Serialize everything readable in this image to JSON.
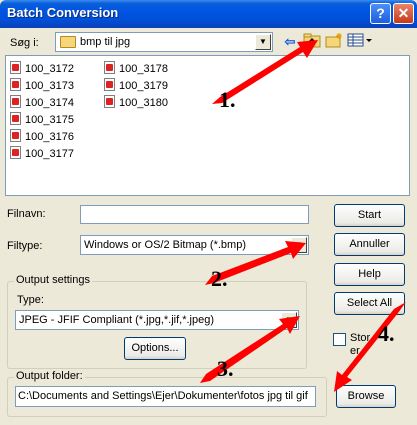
{
  "window": {
    "title": "Batch Conversion",
    "help_glyph": "?",
    "close_glyph": "✕"
  },
  "lookin": {
    "label": "Søg i:",
    "folder": "bmp til jpg"
  },
  "files": [
    "100_3172",
    "100_3173",
    "100_3174",
    "100_3175",
    "100_3176",
    "100_3177",
    "100_3178",
    "100_3179",
    "100_3180"
  ],
  "filename": {
    "label": "Filnavn:",
    "value": ""
  },
  "filetype": {
    "label": "Filtype:",
    "value": "Windows or OS/2 Bitmap (*.bmp)"
  },
  "output_settings": {
    "title": "Output settings",
    "type_label": "Type:",
    "type_value": "JPEG - JFIF Compliant (*.jpg,*.jif,*.jpeg)",
    "options_label": "Options..."
  },
  "output_folder": {
    "title": "Output folder:",
    "path": "C:\\Documents and Settings\\Ejer\\Dokumenter\\fotos jpg til gif",
    "browse_label": "Browse"
  },
  "buttons": {
    "start": "Start",
    "cancel": "Annuller",
    "help": "Help",
    "select_all": "Select All"
  },
  "store_checkbox": {
    "label_line1": "Stor",
    "label_line2": "er",
    "checked": false
  },
  "annotations": {
    "n1": "1.",
    "n2": "2.",
    "n3": "3.",
    "n4": "4.",
    "arrow_color": "#ff0000"
  },
  "icons": {
    "back": "back-arrow-icon",
    "up": "up-folder-icon",
    "new_folder": "new-folder-icon",
    "view": "view-menu-icon"
  }
}
